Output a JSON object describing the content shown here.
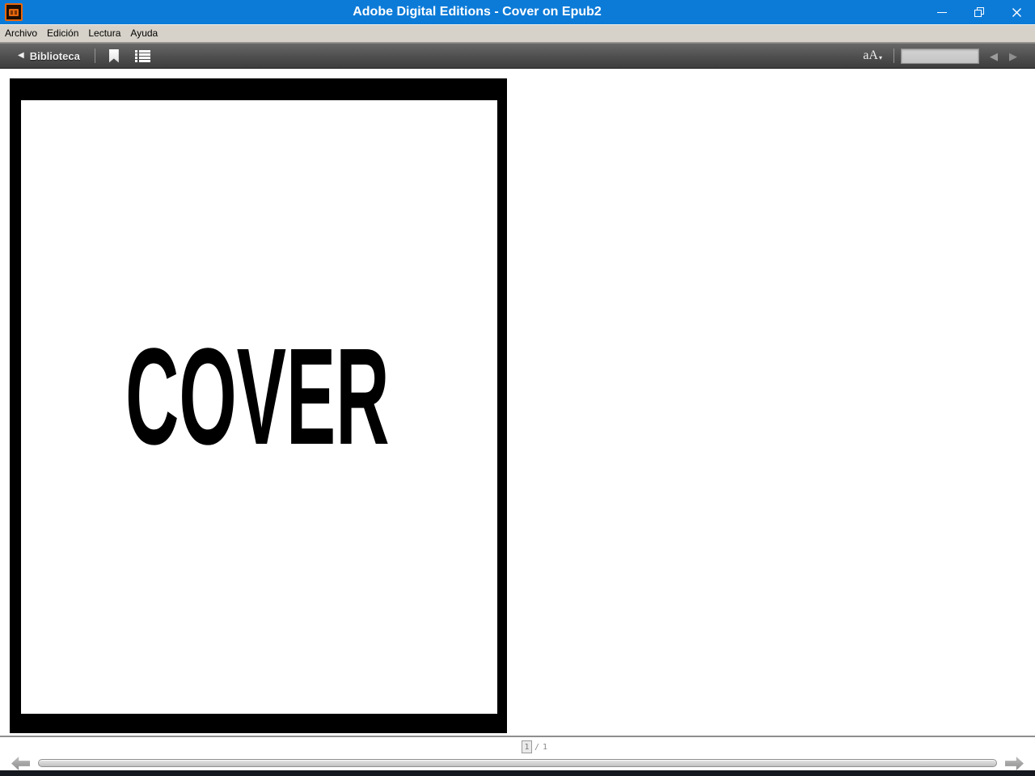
{
  "window": {
    "title": "Adobe Digital Editions - Cover on Epub2",
    "icons": {
      "app_logo": "adobe-digital-editions-logo",
      "minimize": "minimize-icon",
      "restore": "restore-icon",
      "close": "close-icon"
    }
  },
  "menubar": {
    "items": [
      {
        "label": "Archivo"
      },
      {
        "label": "Edición"
      },
      {
        "label": "Lectura"
      },
      {
        "label": "Ayuda"
      }
    ]
  },
  "toolbar": {
    "back_button": {
      "glyph": "◀",
      "label": "Biblioteca"
    },
    "bookmark_icon": "bookmark-ribbon",
    "toc_icon": "table-of-contents-list",
    "font_size": {
      "glyph": "aA",
      "dropdown_glyph": "▾"
    },
    "prev_glyph": "◀",
    "next_glyph": "▶"
  },
  "reader": {
    "cover_text": "COVER"
  },
  "pager": {
    "current_page": "1",
    "separator": "/",
    "total_pages": "1"
  },
  "colors": {
    "titlebar_blue": "#0c7bd8",
    "menubar_gray": "#d6d2c9",
    "toolbar_dark": "#4e4e4e",
    "logo_orange": "#e8670d",
    "bottom_strip": "#161820"
  }
}
